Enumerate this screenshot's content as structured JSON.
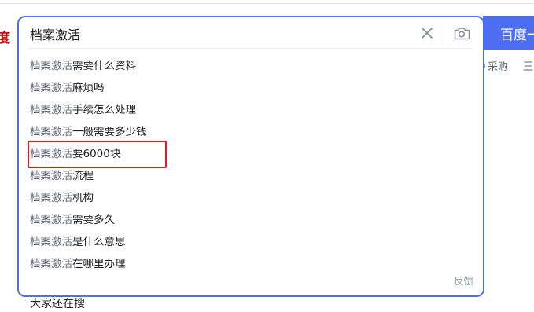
{
  "logo_fragment": "度",
  "search": {
    "query": "档案激活",
    "button_label": "百度一下"
  },
  "background_nav": {
    "item_label": "采购",
    "extra_label": "王"
  },
  "suggestions": [
    {
      "prefix": "档案激活",
      "suffix": "需要什么资料"
    },
    {
      "prefix": "档案激活",
      "suffix": "麻烦吗"
    },
    {
      "prefix": "档案激活",
      "suffix": "手续怎么处理"
    },
    {
      "prefix": "档案激活",
      "suffix": "一般需要多少钱"
    },
    {
      "prefix": "档案激活",
      "suffix": "要6000块"
    },
    {
      "prefix": "档案激活",
      "suffix": "流程"
    },
    {
      "prefix": "档案激活",
      "suffix": "机构"
    },
    {
      "prefix": "档案激活",
      "suffix": "需要多久"
    },
    {
      "prefix": "档案激活",
      "suffix": "是什么意思"
    },
    {
      "prefix": "档案激活",
      "suffix": "在哪里办理"
    }
  ],
  "feedback_label": "反馈",
  "others_searching": "大家还在搜",
  "icons": {
    "clear": "close-icon",
    "camera": "camera-icon"
  },
  "colors": {
    "accent": "#4e6ef2",
    "highlight": "#e31b1b",
    "logo_red": "#e10602"
  }
}
